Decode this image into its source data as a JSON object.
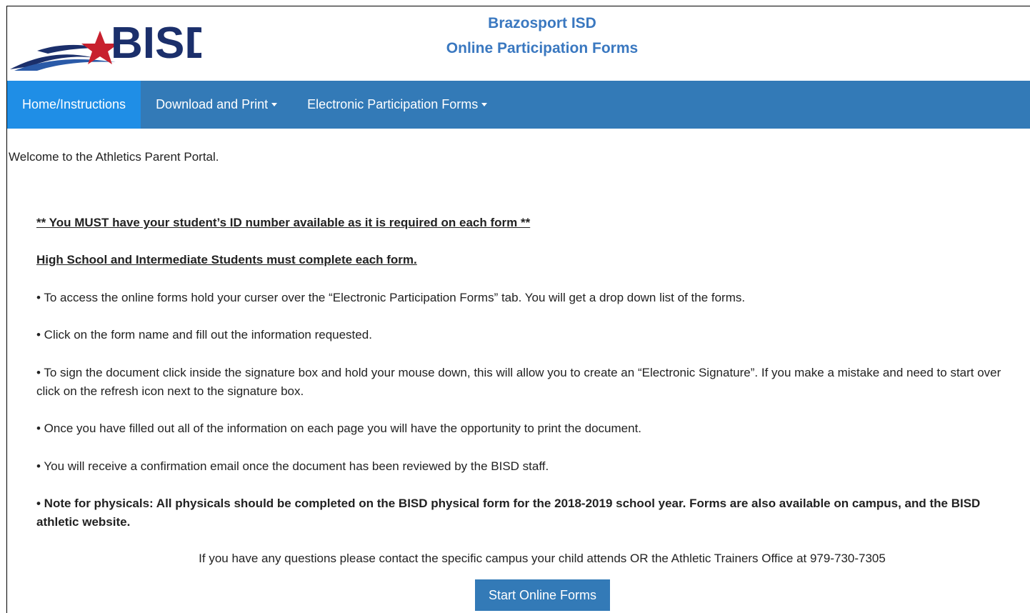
{
  "header": {
    "logo_text": "BISD",
    "title_line1": "Brazosport ISD",
    "title_line2": "Online Participation Forms"
  },
  "nav": {
    "home": "Home/Instructions",
    "download": "Download and Print",
    "electronic": "Electronic Participation Forms"
  },
  "content": {
    "welcome": "Welcome to the Athletics Parent Portal.",
    "required_notice": "** You MUST have your student’s ID number available as it is required on each form **",
    "hs_notice": "High School and Intermediate Students must complete each form.",
    "bullet1": "• To access the online forms hold your curser over the “Electronic Participation Forms” tab. You will get a drop down list of the forms.",
    "bullet2": "• Click on the form name and fill out the information requested.",
    "bullet3": "• To sign the document click inside the signature box and hold your mouse down, this will allow you to create an “Electronic Signature”. If you make a mistake and need to start over click on the refresh icon next to the signature box.",
    "bullet4": "• Once you have filled out all of the information on each page you will have the opportunity to print the document.",
    "bullet5": "• You will receive a confirmation email once the document has been reviewed by the BISD staff.",
    "note": "• Note for physicals: All physicals should be completed on the BISD physical form for the 2018-2019 school year. Forms are also available on campus, and the BISD athletic website.",
    "contact": "If you have any questions please contact the specific campus your child attends OR the Athletic Trainers Office at 979-730-7305",
    "start_button": "Start Online Forms"
  },
  "colors": {
    "nav_bg": "#337ab7",
    "nav_active": "#1f8ee6",
    "title": "#3a78c0",
    "logo_navy": "#1b2f6b",
    "logo_red": "#c8202e"
  }
}
